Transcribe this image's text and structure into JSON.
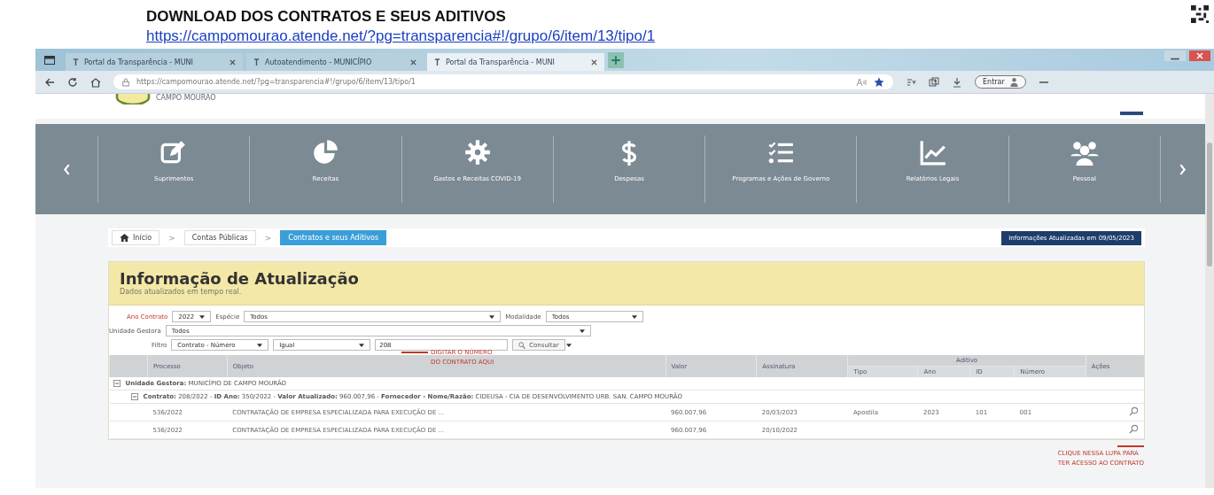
{
  "document": {
    "title": "DOWNLOAD DOS CONTRATOS E SEUS ADITIVOS",
    "link": "https://campomourao.atende.net/?pg=transparencia#!/grupo/6/item/13/tipo/1"
  },
  "browser": {
    "tabs": [
      {
        "title": "Portal da Transparência - MUNI",
        "selected": false
      },
      {
        "title": "Autoatendimento - MUNICÍPIO",
        "selected": false
      },
      {
        "title": "Portal da Transparência - MUNI",
        "selected": true
      }
    ],
    "address": "https://campomourao.atende.net/?pg=transparencia#!/grupo/6/item/13/tipo/1",
    "sign_in": "Entrar"
  },
  "site": {
    "logo_text": "CAMPO MOURÃO",
    "nav": [
      {
        "label": "Suprimentos",
        "kind": "edit"
      },
      {
        "label": "Receitas",
        "kind": "pie"
      },
      {
        "label": "Gastos e Receitas COVID-19",
        "kind": "gear"
      },
      {
        "label": "Despesas",
        "kind": "dollar"
      },
      {
        "label": "Programas e Ações de Governo",
        "kind": "checklist"
      },
      {
        "label": "Relatórios Legais",
        "kind": "chart"
      },
      {
        "label": "Pessoal",
        "kind": "people"
      }
    ],
    "breadcrumb_separator": ">",
    "breadcrumb": [
      {
        "label": "Início",
        "selected": false
      },
      {
        "label": "Contas Públicas",
        "selected": false
      },
      {
        "label": "Contratos e seus Aditivos",
        "selected": true
      }
    ],
    "update_badge": "Informações Atualizadas em 09/05/2023"
  },
  "panel": {
    "title": "Informação de Atualização",
    "subtitle": "Dados atualizados em tempo real.",
    "filter_rows": [
      [
        {
          "kind": "select",
          "label": "Ano Contrato",
          "value": "2022"
        },
        {
          "kind": "select",
          "label": "Espécie",
          "value": "Todos"
        },
        {
          "kind": "select",
          "label": "Modalidade",
          "value": "Todos"
        }
      ],
      [
        {
          "kind": "select",
          "label": "Unidade Gestora",
          "value": "Todos"
        }
      ],
      [
        {
          "kind": "select",
          "label": "Filtro",
          "value": "Contrato - Número"
        },
        {
          "kind": "select",
          "value": "Igual"
        },
        {
          "kind": "input",
          "value": "208"
        },
        {
          "kind": "button",
          "value": "Consultar"
        }
      ]
    ]
  },
  "table": {
    "columns": [
      "Processo",
      "Objeto",
      "Valor",
      "Assinatura"
    ],
    "aditivo": "Aditivo",
    "aditivo_columns": [
      "Tipo",
      "Ano",
      "ID",
      "Número"
    ],
    "actions": "Ações",
    "group_row": "Unidade Gestora: MUNICÍPIO DE CAMPO MOURÃO",
    "contract_row": "**Contrato:** 208/2022 - **ID Ano:** 350/2022 - **Valor Atualizado:** 960.007,96 - **Fornecedor - Nome/Razão:** CIDEUSA - CIA DE DESENVOLVIMENTO URB. SAN. CAMPO MOURÃO",
    "rows": [
      {
        "cells": [
          "536/2022",
          "CONTRATAÇÃO DE EMPRESA ESPECIALIZADA PARA EXECUÇÃO DE ...",
          "960.007,96",
          "20/03/2023",
          "Apostila",
          "2023",
          "101",
          "001"
        ]
      },
      {
        "cells": [
          "536/2022",
          "CONTRATAÇÃO DE EMPRESA ESPECIALIZADA PARA EXECUÇÃO DE ...",
          "960.007,96",
          "20/10/2022"
        ]
      }
    ]
  },
  "annotations": [
    {
      "kind": "filter",
      "text": "DIGITAR O NÚMERO\nDO CONTRATO AQUI"
    },
    {
      "kind": "action",
      "text": "CLIQUE NESSA LUPA PARA\nTER ACESSO AO CONTRATO"
    }
  ]
}
